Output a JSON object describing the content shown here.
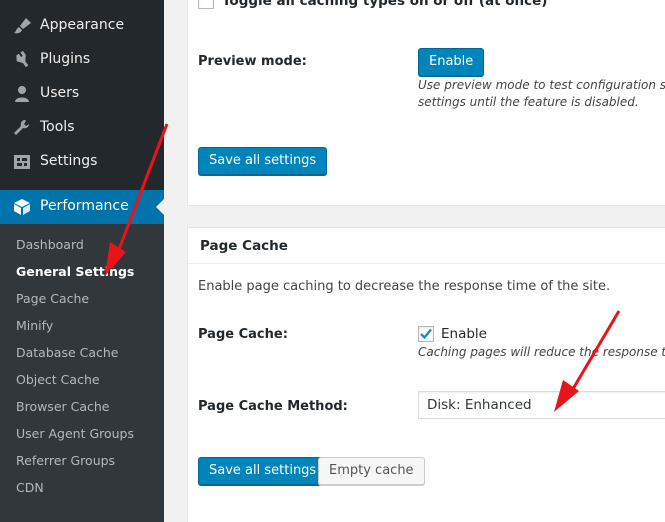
{
  "sidebar": {
    "menu": [
      {
        "label": "Appearance",
        "icon": "paintbrush-icon"
      },
      {
        "label": "Plugins",
        "icon": "plugin-icon"
      },
      {
        "label": "Users",
        "icon": "user-icon"
      },
      {
        "label": "Tools",
        "icon": "wrench-icon"
      },
      {
        "label": "Settings",
        "icon": "settings-icon"
      },
      {
        "label": "Performance",
        "icon": "performance-icon",
        "active": true
      }
    ],
    "submenu": [
      "Dashboard",
      "General Settings",
      "Page Cache",
      "Minify",
      "Database Cache",
      "Object Cache",
      "Browser Cache",
      "User Agent Groups",
      "Referrer Groups",
      "CDN"
    ],
    "current_submenu": "General Settings"
  },
  "general_panel": {
    "toggle_label": "Toggle all caching types on or off (at once)",
    "preview_label": "Preview mode:",
    "enable_button": "Enable",
    "preview_desc_line1": "Use preview mode to test configuration scen",
    "preview_desc_line2": "settings until the feature is disabled.",
    "save_button": "Save all settings"
  },
  "page_cache_panel": {
    "title": "Page Cache",
    "intro": "Enable page caching to decrease the response time of the site.",
    "page_cache_label": "Page Cache:",
    "enable_checkbox_label": "Enable",
    "enable_checked": true,
    "enable_desc": "Caching pages will reduce the response time",
    "method_label": "Page Cache Method:",
    "method_value": "Disk: Enhanced",
    "save_button": "Save all settings",
    "empty_button": "Empty cache"
  },
  "colors": {
    "sidebar_bg": "#23282d",
    "submenu_bg": "#32373c",
    "accent": "#0073aa",
    "button_primary": "#0085ba",
    "annotation_arrow": "#e8141b"
  }
}
